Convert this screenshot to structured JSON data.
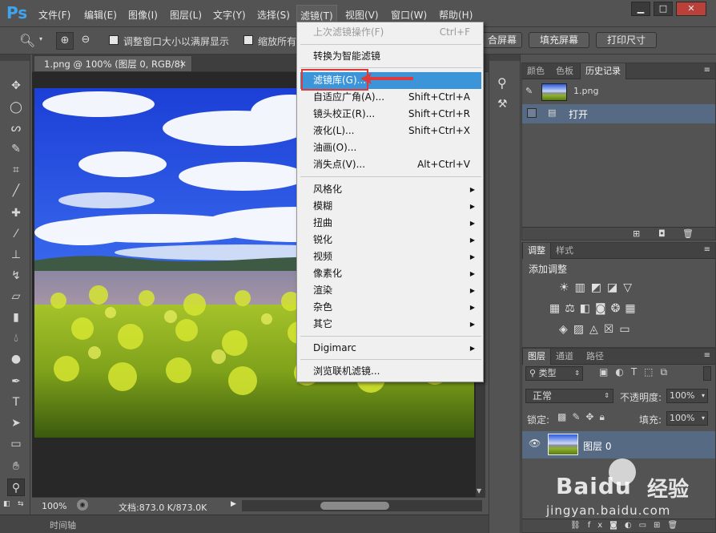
{
  "app": {
    "logo": "Ps"
  },
  "menubar": {
    "items": [
      "文件(F)",
      "编辑(E)",
      "图像(I)",
      "图层(L)",
      "文字(Y)",
      "选择(S)",
      "滤镜(T)",
      "视图(V)",
      "窗口(W)",
      "帮助(H)"
    ],
    "active": "滤镜(T)"
  },
  "options": {
    "resize_label": "调整窗口大小以满屏显示",
    "zoom_all_label": "缩放所有",
    "fit_label": "合屏幕",
    "fill_label": "填充屏幕",
    "print_label": "打印尺寸"
  },
  "document": {
    "tab_title": "1.png @ 100% (图层 0, RGB/8)",
    "zoom": "100%",
    "doc_info": "文档:873.0 K/873.0K"
  },
  "timeline": {
    "label": "时间轴"
  },
  "filter_menu": {
    "last_filter": "上次滤镜操作(F)",
    "last_filter_shortcut": "Ctrl+F",
    "smart": "转换为智能滤镜",
    "gallery": "滤镜库(G)...",
    "adaptive": "自适应广角(A)...",
    "adaptive_shortcut": "Shift+Ctrl+A",
    "lens": "镜头校正(R)...",
    "lens_shortcut": "Shift+Ctrl+R",
    "liquify": "液化(L)...",
    "liquify_shortcut": "Shift+Ctrl+X",
    "oil": "油画(O)...",
    "vanish": "消失点(V)...",
    "vanish_shortcut": "Alt+Ctrl+V",
    "submenus": [
      "风格化",
      "模糊",
      "扭曲",
      "锐化",
      "视频",
      "像素化",
      "渲染",
      "杂色",
      "其它"
    ],
    "digimarc": "Digimarc",
    "browse": "浏览联机滤镜..."
  },
  "history_panel": {
    "tabs": [
      "颜色",
      "色板",
      "历史记录"
    ],
    "active_tab": "历史记录",
    "snapshot": "1.png",
    "step": "打开"
  },
  "adjust_panel": {
    "tabs": [
      "调整",
      "样式"
    ],
    "active_tab": "调整",
    "title": "添加调整"
  },
  "layers_panel": {
    "tabs": [
      "图层",
      "通道",
      "路径"
    ],
    "active_tab": "图层",
    "kind": "类型",
    "blend": "正常",
    "opacity_label": "不透明度:",
    "opacity": "100%",
    "lock_label": "锁定:",
    "fill_label": "填充:",
    "fill": "100%",
    "layer_name": "图层 0"
  },
  "watermark": {
    "brand": "Baidu",
    "brand2": "经验",
    "url": "jingyan.baidu.com"
  },
  "colors": {
    "accent": "#3d95d9",
    "highlight_box": "#e03a3a"
  }
}
